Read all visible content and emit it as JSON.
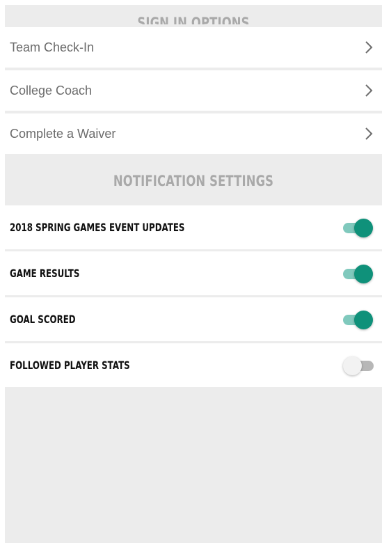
{
  "sections": {
    "signin_header": "SIGN IN OPTIONS",
    "notification_header": "NOTIFICATION SETTINGS"
  },
  "nav_items": [
    {
      "label": "Team Check-In",
      "icon": "chevron-right-icon"
    },
    {
      "label": "College Coach",
      "icon": "chevron-right-icon"
    },
    {
      "label": "Complete a Waiver",
      "icon": "chevron-right-icon"
    }
  ],
  "notifications": [
    {
      "label": "2018 SPRING GAMES EVENT UPDATES",
      "enabled": true
    },
    {
      "label": "GAME RESULTS",
      "enabled": true
    },
    {
      "label": "GOAL SCORED",
      "enabled": true
    },
    {
      "label": "FOLLOWED PLAYER STATS",
      "enabled": false
    }
  ],
  "colors": {
    "accent": "#0f917a",
    "accent_track": "#80c9bd",
    "background": "#ececec",
    "header_text": "#a9a9a9"
  }
}
